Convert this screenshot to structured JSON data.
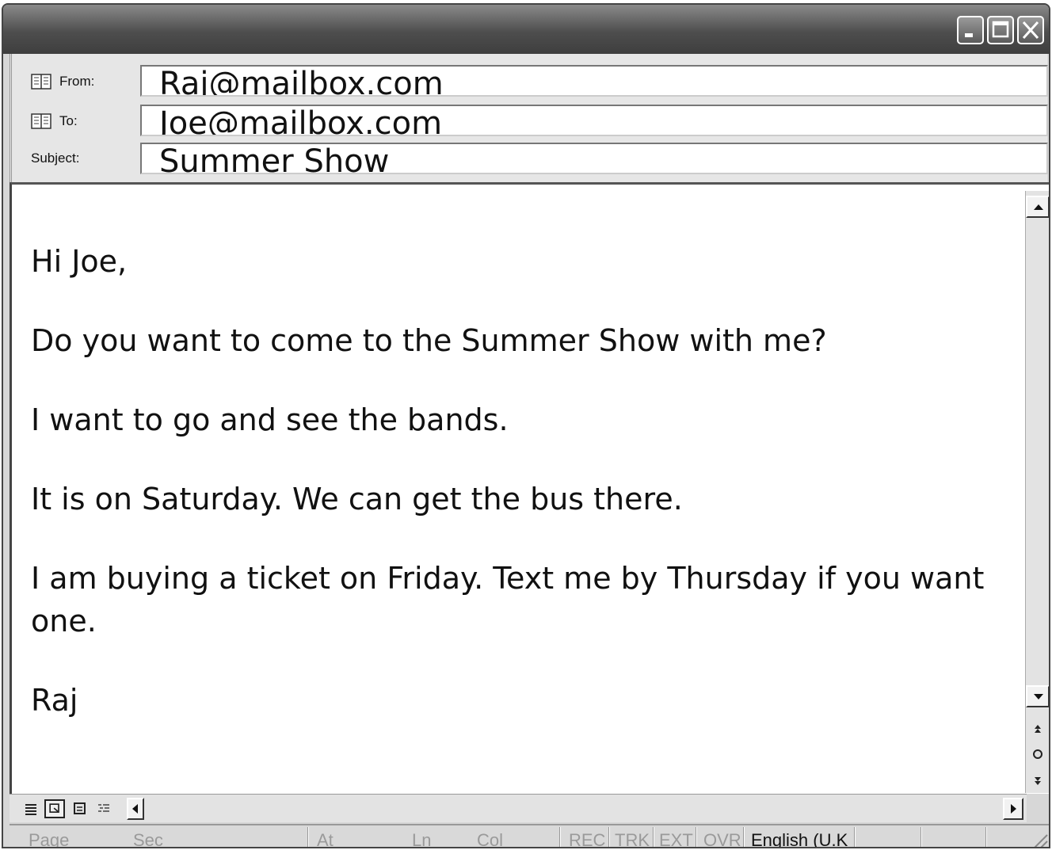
{
  "window": {
    "minimize_icon": "minimize-icon",
    "maximize_icon": "maximize-icon",
    "close_icon": "close-icon"
  },
  "header": {
    "from_label": "From:",
    "from_value": "Raj@mailbox.com",
    "to_label": "To:",
    "to_value": "Joe@mailbox.com",
    "subject_label": "Subject:",
    "subject_value": "Summer Show",
    "address_book_icon": "address-book-icon"
  },
  "message": {
    "greeting": "Hi Joe,",
    "line1": "Do you want to come to the Summer Show with me?",
    "line2": "I want to go and see the bands.",
    "line3": "It is on Saturday. We can get the bus there.",
    "line4": "I am buying a ticket on Friday. Text me by Thursday if you want one.",
    "signature": "Raj"
  },
  "statusbar": {
    "page": "Page",
    "sec": "Sec",
    "at": "At",
    "ln": "Ln",
    "col": "Col",
    "rec": "REC",
    "trk": "TRK",
    "ext": "EXT",
    "ovr": "OVR",
    "language": "English (U.K"
  }
}
